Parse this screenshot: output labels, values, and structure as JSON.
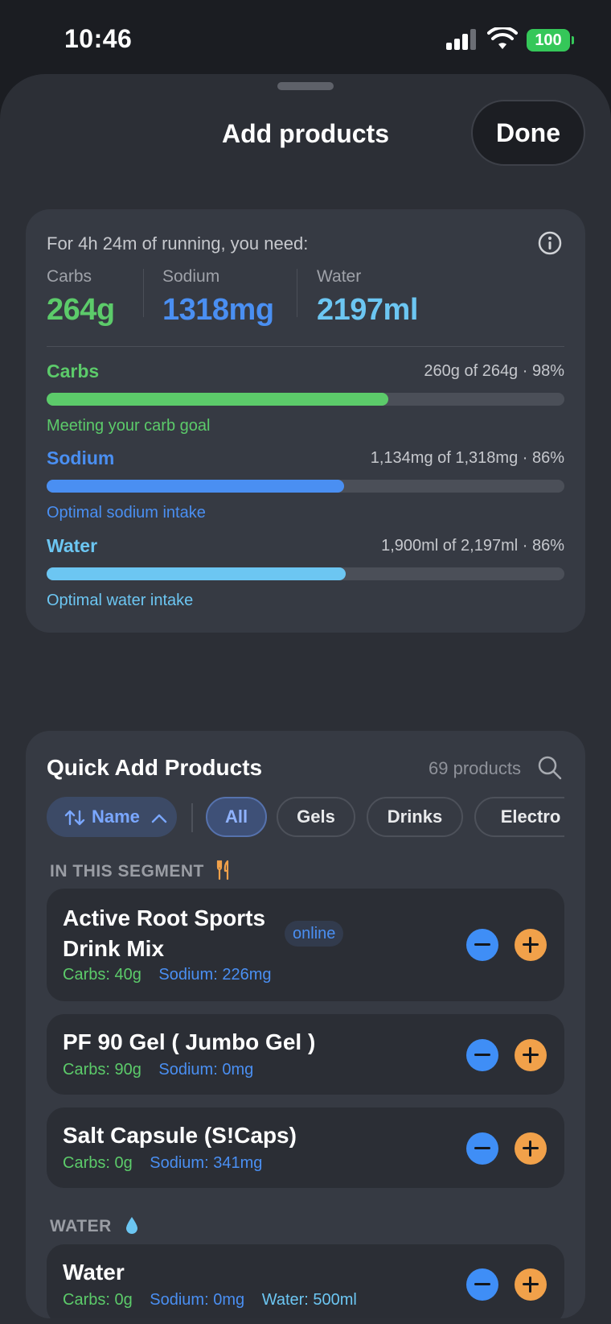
{
  "status_bar": {
    "time": "10:46",
    "battery": "100"
  },
  "sheet": {
    "title": "Add products",
    "done_label": "Done"
  },
  "needs": {
    "header": "For 4h 24m of running, you need:",
    "metrics": [
      {
        "label": "Carbs",
        "value": "264g",
        "color": "#5ccb6a"
      },
      {
        "label": "Sodium",
        "value": "1318mg",
        "color": "#4a8ff2"
      },
      {
        "label": "Water",
        "value": "2197ml",
        "color": "#6cc6f2"
      }
    ],
    "progress": [
      {
        "name": "Carbs",
        "stat": "260g of 264g · 98%",
        "fill": 0.66,
        "note": "Meeting your carb goal",
        "color": "#5ccb6a"
      },
      {
        "name": "Sodium",
        "stat": "1,134mg of 1,318mg · 86%",
        "fill": 0.575,
        "note": "Optimal sodium intake",
        "color": "#4a8ff2"
      },
      {
        "name": "Water",
        "stat": "1,900ml of 2,197ml · 86%",
        "fill": 0.578,
        "note": "Optimal water intake",
        "color": "#6cc6f2"
      }
    ]
  },
  "quick_add": {
    "title": "Quick Add Products",
    "count": "69 products",
    "sort_label": "Name",
    "filters": [
      "All",
      "Gels",
      "Drinks",
      "Electro"
    ],
    "active_filter": "All",
    "segment_label": "IN THIS SEGMENT",
    "water_label": "WATER",
    "products": [
      {
        "name_line1": "Active Root Sports",
        "name_line2": "Drink Mix",
        "badge": "online",
        "carbs": "Carbs: 40g",
        "sodium": "Sodium: 226mg"
      },
      {
        "name_line1": "PF 90 Gel ( Jumbo Gel )",
        "carbs": "Carbs: 90g",
        "sodium": "Sodium: 0mg"
      },
      {
        "name_line1": "Salt Capsule (S!Caps)",
        "carbs": "Carbs: 0g",
        "sodium": "Sodium: 341mg"
      }
    ],
    "water_product": {
      "name": "Water",
      "carbs": "Carbs: 0g",
      "sodium": "Sodium: 0mg",
      "water": "Water: 500ml"
    }
  }
}
